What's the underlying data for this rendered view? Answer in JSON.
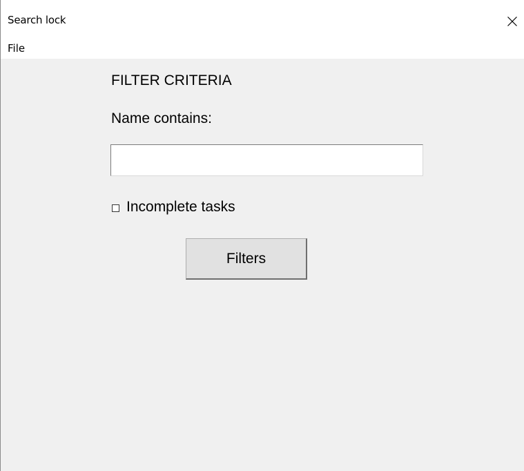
{
  "window": {
    "title": "Search lock",
    "close_icon": "close-icon"
  },
  "menubar": {
    "items": [
      {
        "label": "File"
      }
    ]
  },
  "filter_panel": {
    "heading": "FILTER CRITERIA",
    "name_label": "Name contains:",
    "name_value": "",
    "incomplete_checkbox": {
      "label": "Incomplete tasks",
      "checked": false
    },
    "filters_button_label": "Filters"
  },
  "colors": {
    "client_background": "#f0f0f0",
    "titlebar_background": "#ffffff",
    "button_face": "#e1e1e1"
  }
}
